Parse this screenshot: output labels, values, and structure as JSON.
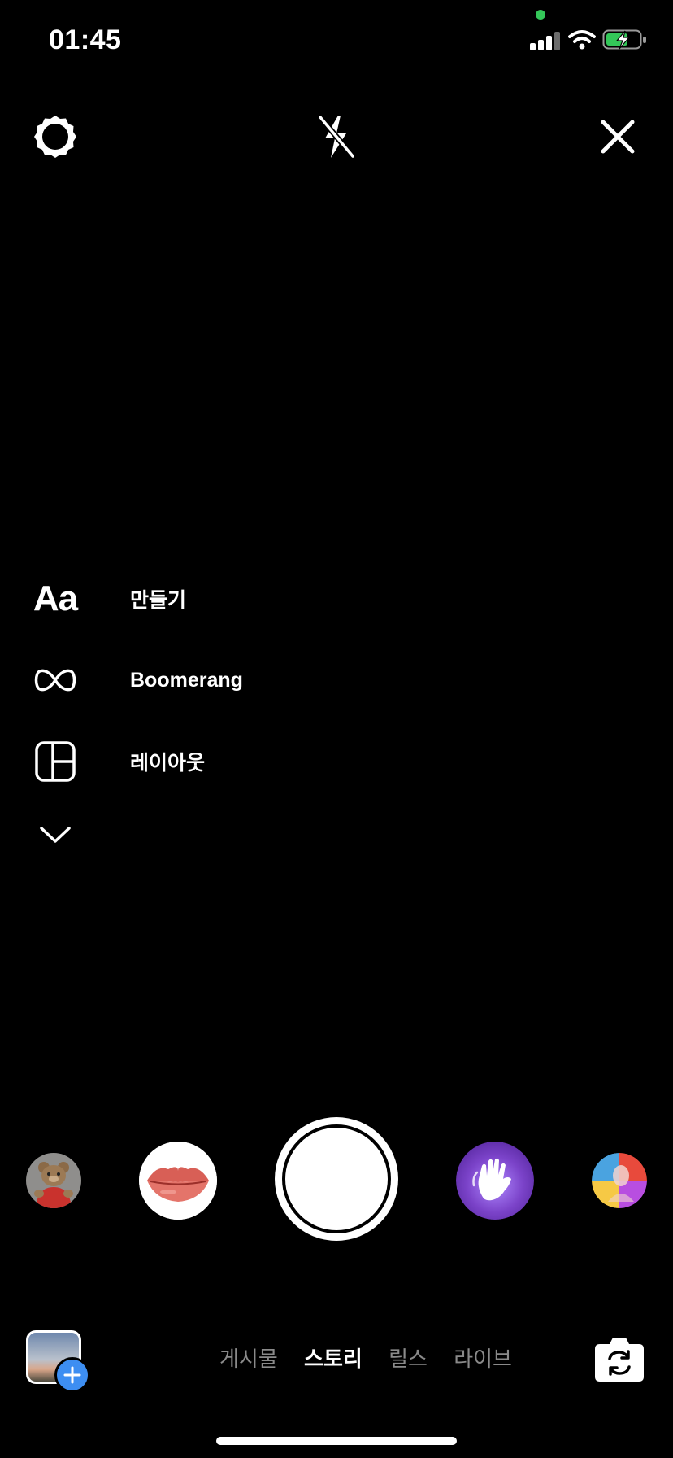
{
  "status_bar": {
    "time": "01:45",
    "camera_in_use_color": "#34c759",
    "battery_charging_color": "#34c759"
  },
  "top_controls": {
    "settings_icon": "gear-icon",
    "flash_icon": "flash-off-icon",
    "close_icon": "close-icon"
  },
  "side_menu": {
    "items": [
      {
        "icon": "Aa",
        "label": "만들기"
      },
      {
        "icon": "infinity-icon",
        "label": "Boomerang"
      },
      {
        "icon": "layout-icon",
        "label": "레이아웃"
      }
    ],
    "expand_icon": "chevron-down-icon"
  },
  "effects": [
    {
      "name": "teddy-bear-effect"
    },
    {
      "name": "lips-effect"
    },
    {
      "name": "wave-hand-effect"
    },
    {
      "name": "color-face-effect"
    }
  ],
  "modes": {
    "items": [
      "게시물",
      "스토리",
      "릴스",
      "라이브"
    ],
    "active": "스토리"
  },
  "colors": {
    "background": "#000000",
    "inactive_mode": "#8a8a8a",
    "accent_blue": "#3d8ef2"
  }
}
